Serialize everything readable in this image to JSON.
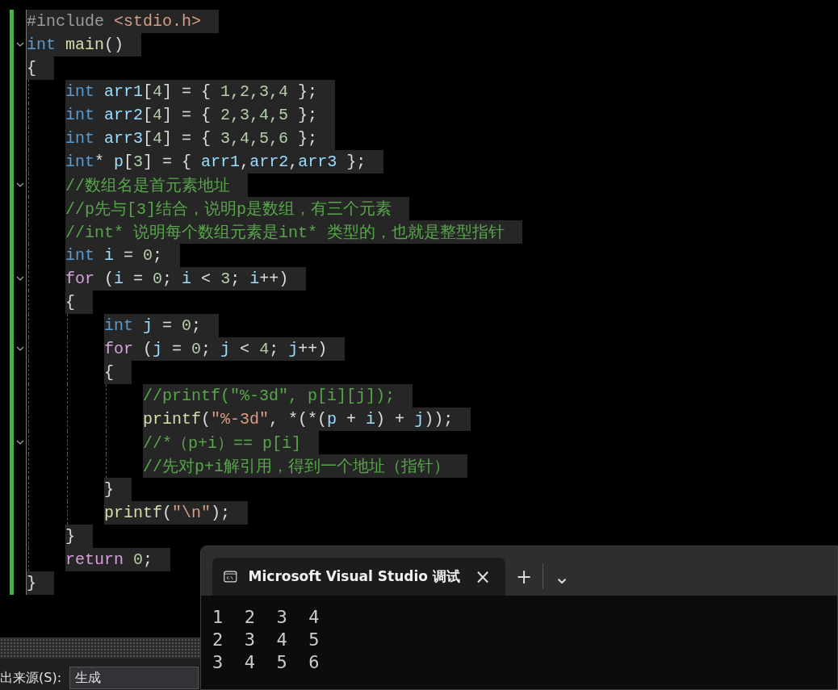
{
  "editor": {
    "lines": [
      {
        "fold": false,
        "tokens": [
          {
            "kind": "pre",
            "text": "#include "
          },
          {
            "kind": "str",
            "text": "<stdio.h>"
          }
        ]
      },
      {
        "fold": true,
        "tokens": [
          {
            "kind": "type",
            "text": "int "
          },
          {
            "kind": "fn",
            "text": "main"
          },
          {
            "kind": "plain",
            "text": "()"
          }
        ]
      },
      {
        "fold": false,
        "tokens": [
          {
            "kind": "plain",
            "text": "{"
          }
        ],
        "children": [
          {
            "fold": false,
            "tokens": [
              {
                "kind": "type",
                "text": "int "
              },
              {
                "kind": "var",
                "text": "arr1"
              },
              {
                "kind": "plain",
                "text": "["
              },
              {
                "kind": "num",
                "text": "4"
              },
              {
                "kind": "plain",
                "text": "] = { "
              },
              {
                "kind": "num",
                "text": "1,2,3,4"
              },
              {
                "kind": "plain",
                "text": " };"
              }
            ]
          },
          {
            "fold": false,
            "tokens": [
              {
                "kind": "type",
                "text": "int "
              },
              {
                "kind": "var",
                "text": "arr2"
              },
              {
                "kind": "plain",
                "text": "["
              },
              {
                "kind": "num",
                "text": "4"
              },
              {
                "kind": "plain",
                "text": "] = { "
              },
              {
                "kind": "num",
                "text": "2,3,4,5"
              },
              {
                "kind": "plain",
                "text": " };"
              }
            ]
          },
          {
            "fold": false,
            "tokens": [
              {
                "kind": "type",
                "text": "int "
              },
              {
                "kind": "var",
                "text": "arr3"
              },
              {
                "kind": "plain",
                "text": "["
              },
              {
                "kind": "num",
                "text": "4"
              },
              {
                "kind": "plain",
                "text": "] = { "
              },
              {
                "kind": "num",
                "text": "3,4,5,6"
              },
              {
                "kind": "plain",
                "text": " };"
              }
            ]
          },
          {
            "fold": false,
            "tokens": [
              {
                "kind": "type",
                "text": "int"
              },
              {
                "kind": "plain",
                "text": "* "
              },
              {
                "kind": "var",
                "text": "p"
              },
              {
                "kind": "plain",
                "text": "["
              },
              {
                "kind": "num",
                "text": "3"
              },
              {
                "kind": "plain",
                "text": "] = { "
              },
              {
                "kind": "var",
                "text": "arr1"
              },
              {
                "kind": "plain",
                "text": ","
              },
              {
                "kind": "var",
                "text": "arr2"
              },
              {
                "kind": "plain",
                "text": ","
              },
              {
                "kind": "var",
                "text": "arr3"
              },
              {
                "kind": "plain",
                "text": " };"
              }
            ]
          },
          {
            "fold": true,
            "tokens": [
              {
                "kind": "comment",
                "text": "//数组名是首元素地址"
              }
            ]
          },
          {
            "fold": false,
            "tokens": [
              {
                "kind": "comment",
                "text": "//p先与[3]结合，说明p是数组，有三个元素"
              }
            ]
          },
          {
            "fold": false,
            "tokens": [
              {
                "kind": "comment",
                "text": "//int* 说明每个数组元素是int* 类型的，也就是整型指针"
              }
            ]
          },
          {
            "fold": false,
            "tokens": [
              {
                "kind": "type",
                "text": "int "
              },
              {
                "kind": "var",
                "text": "i"
              },
              {
                "kind": "plain",
                "text": " = "
              },
              {
                "kind": "num",
                "text": "0"
              },
              {
                "kind": "plain",
                "text": ";"
              }
            ]
          },
          {
            "fold": true,
            "tokens": [
              {
                "kind": "ctl",
                "text": "for"
              },
              {
                "kind": "plain",
                "text": " ("
              },
              {
                "kind": "var",
                "text": "i"
              },
              {
                "kind": "plain",
                "text": " = "
              },
              {
                "kind": "num",
                "text": "0"
              },
              {
                "kind": "plain",
                "text": "; "
              },
              {
                "kind": "var",
                "text": "i"
              },
              {
                "kind": "plain",
                "text": " < "
              },
              {
                "kind": "num",
                "text": "3"
              },
              {
                "kind": "plain",
                "text": "; "
              },
              {
                "kind": "var",
                "text": "i"
              },
              {
                "kind": "plain",
                "text": "++)"
              }
            ]
          },
          {
            "fold": false,
            "tokens": [
              {
                "kind": "plain",
                "text": "{"
              }
            ],
            "children": [
              {
                "fold": false,
                "tokens": [
                  {
                    "kind": "type",
                    "text": "int "
                  },
                  {
                    "kind": "var",
                    "text": "j"
                  },
                  {
                    "kind": "plain",
                    "text": " = "
                  },
                  {
                    "kind": "num",
                    "text": "0"
                  },
                  {
                    "kind": "plain",
                    "text": ";"
                  }
                ]
              },
              {
                "fold": true,
                "tokens": [
                  {
                    "kind": "ctl",
                    "text": "for"
                  },
                  {
                    "kind": "plain",
                    "text": " ("
                  },
                  {
                    "kind": "var",
                    "text": "j"
                  },
                  {
                    "kind": "plain",
                    "text": " = "
                  },
                  {
                    "kind": "num",
                    "text": "0"
                  },
                  {
                    "kind": "plain",
                    "text": "; "
                  },
                  {
                    "kind": "var",
                    "text": "j"
                  },
                  {
                    "kind": "plain",
                    "text": " < "
                  },
                  {
                    "kind": "num",
                    "text": "4"
                  },
                  {
                    "kind": "plain",
                    "text": "; "
                  },
                  {
                    "kind": "var",
                    "text": "j"
                  },
                  {
                    "kind": "plain",
                    "text": "++)"
                  }
                ]
              },
              {
                "fold": false,
                "tokens": [
                  {
                    "kind": "plain",
                    "text": "{"
                  }
                ],
                "children": [
                  {
                    "fold": false,
                    "tokens": [
                      {
                        "kind": "comment",
                        "text": "//printf(\"%-3d\", p[i][j]);"
                      }
                    ]
                  },
                  {
                    "fold": false,
                    "tokens": [
                      {
                        "kind": "fn",
                        "text": "printf"
                      },
                      {
                        "kind": "plain",
                        "text": "("
                      },
                      {
                        "kind": "str",
                        "text": "\"%-3d\""
                      },
                      {
                        "kind": "plain",
                        "text": ", *(*("
                      },
                      {
                        "kind": "var",
                        "text": "p"
                      },
                      {
                        "kind": "plain",
                        "text": " + "
                      },
                      {
                        "kind": "var",
                        "text": "i"
                      },
                      {
                        "kind": "plain",
                        "text": ") + "
                      },
                      {
                        "kind": "var",
                        "text": "j"
                      },
                      {
                        "kind": "plain",
                        "text": "));"
                      }
                    ]
                  },
                  {
                    "fold": true,
                    "tokens": [
                      {
                        "kind": "comment",
                        "text": "//*（p+i）== p[i]"
                      }
                    ]
                  },
                  {
                    "fold": false,
                    "tokens": [
                      {
                        "kind": "comment",
                        "text": "//先对p+i解引用，得到一个地址（指针）"
                      }
                    ]
                  }
                ]
              },
              {
                "fold": false,
                "tokens": [
                  {
                    "kind": "plain",
                    "text": "}"
                  }
                ]
              },
              {
                "fold": false,
                "tokens": [
                  {
                    "kind": "fn",
                    "text": "printf"
                  },
                  {
                    "kind": "plain",
                    "text": "("
                  },
                  {
                    "kind": "str",
                    "text": "\"\\n\""
                  },
                  {
                    "kind": "plain",
                    "text": ");"
                  }
                ]
              }
            ]
          },
          {
            "fold": false,
            "tokens": [
              {
                "kind": "plain",
                "text": "}"
              }
            ]
          },
          {
            "fold": false,
            "tokens": [
              {
                "kind": "ctl",
                "text": "return "
              },
              {
                "kind": "num",
                "text": "0"
              },
              {
                "kind": "plain",
                "text": ";"
              }
            ]
          }
        ]
      },
      {
        "fold": false,
        "tokens": [
          {
            "kind": "plain",
            "text": "}"
          }
        ]
      }
    ]
  },
  "output_panel": {
    "source_label": "出来源(S):",
    "source_value": "生成"
  },
  "terminal": {
    "tab_title": "Microsoft Visual Studio 调试",
    "close": "×",
    "new_tab": "+",
    "dropdown": "⌄",
    "output": [
      "1  2  3  4",
      "2  3  4  5",
      "3  4  5  6"
    ]
  }
}
